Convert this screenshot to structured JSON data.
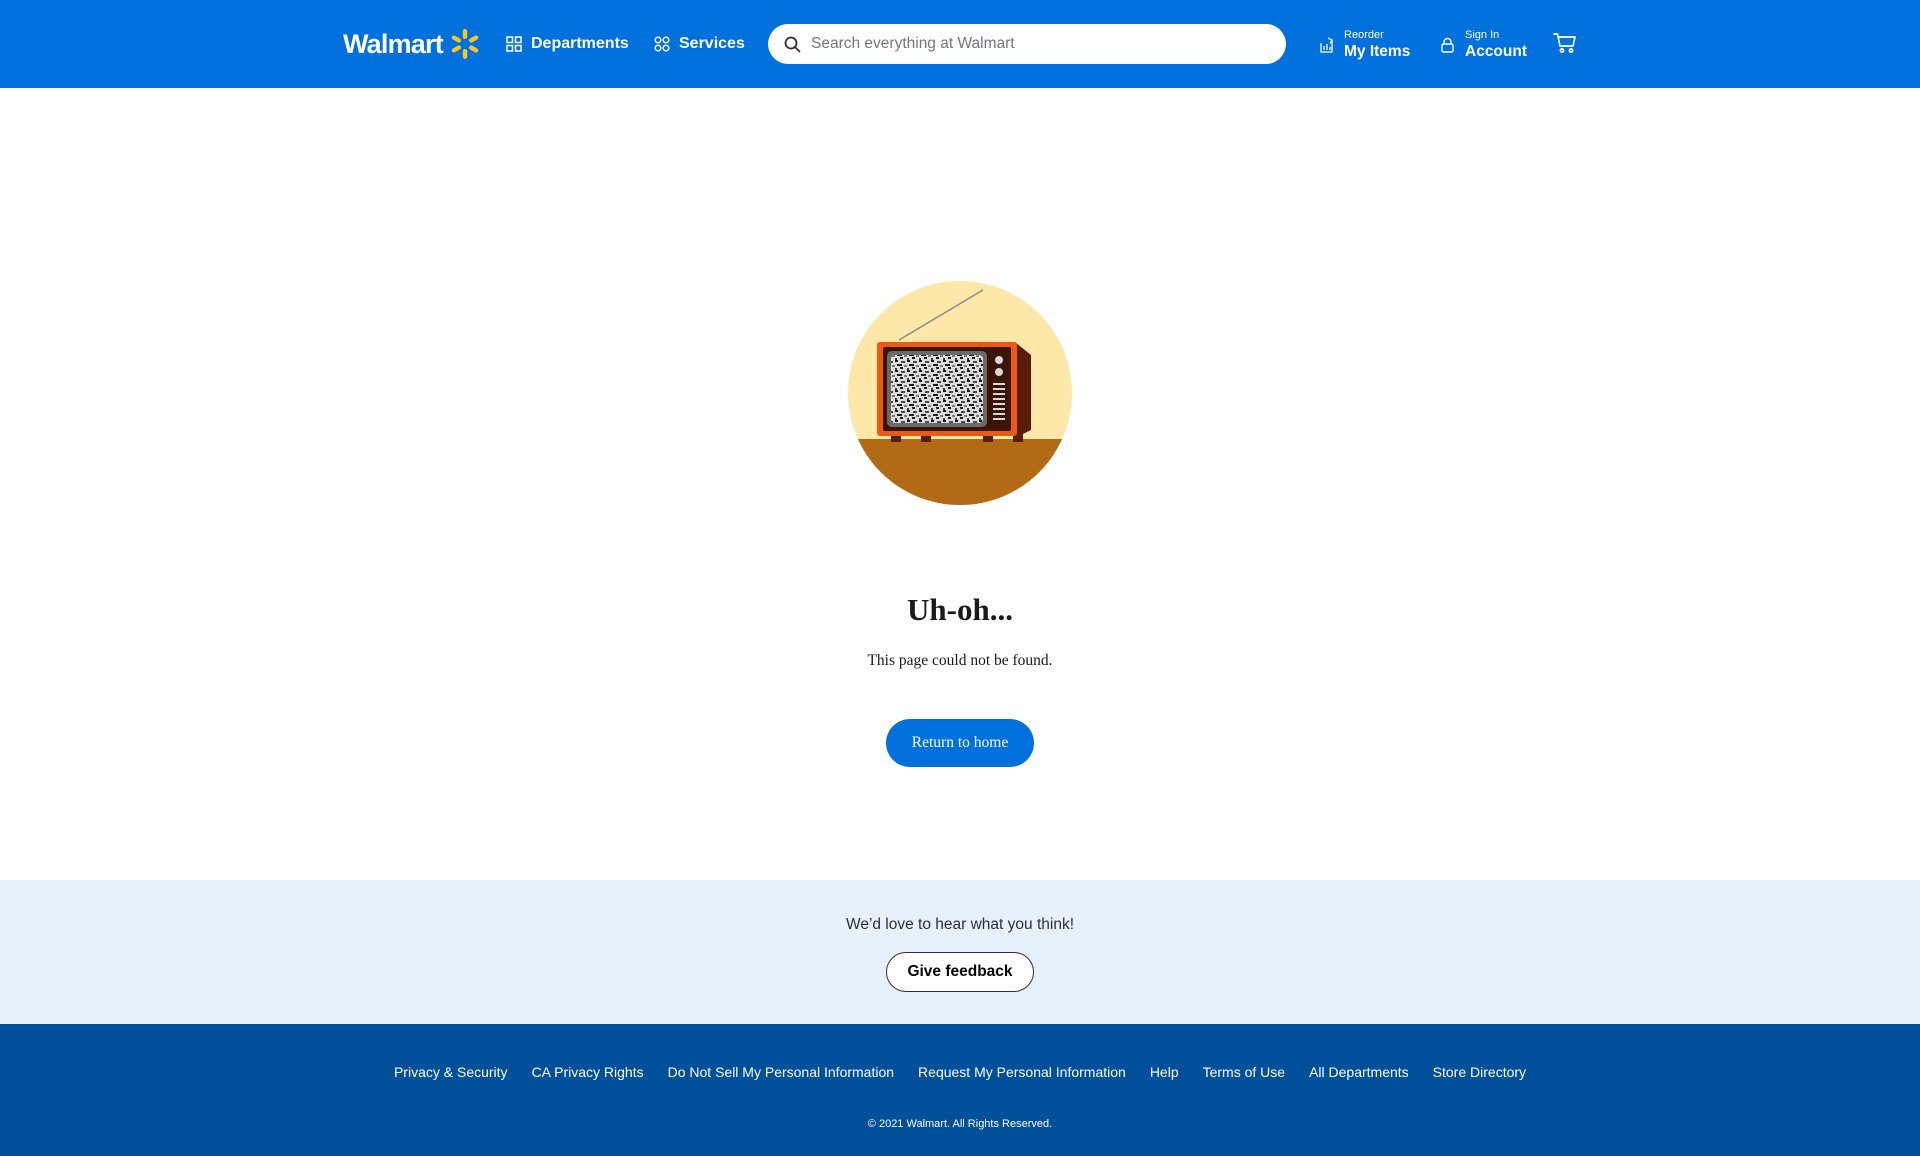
{
  "header": {
    "logo_text": "Walmart",
    "departments_label": "Departments",
    "services_label": "Services",
    "search_placeholder": "Search everything at Walmart",
    "reorder": {
      "small": "Reorder",
      "big": "My Items"
    },
    "account": {
      "small": "Sign In",
      "big": "Account"
    }
  },
  "main": {
    "title": "Uh-oh...",
    "subtitle": "This page could not be found.",
    "return_label": "Return to home"
  },
  "feedback": {
    "prompt": "We’d love to hear what you think!",
    "button_label": "Give feedback"
  },
  "footer": {
    "links": [
      "Privacy & Security",
      "CA Privacy Rights",
      "Do Not Sell My Personal Information",
      "Request My Personal Information",
      "Help",
      "Terms of Use",
      "All Departments",
      "Store Directory"
    ],
    "copyright": "© 2021 Walmart. All Rights Reserved."
  },
  "colors": {
    "header_bg": "#0071dc",
    "spark": "#ffc220",
    "feedback_bg": "#e6f1fc",
    "footer_bg": "#004f9a"
  },
  "icons": {
    "logo": "walmart-spark-icon",
    "departments": "grid-icon",
    "services": "services-grid-icon",
    "search": "search-icon",
    "reorder": "reorder-icon",
    "account": "user-icon",
    "cart": "cart-icon"
  }
}
